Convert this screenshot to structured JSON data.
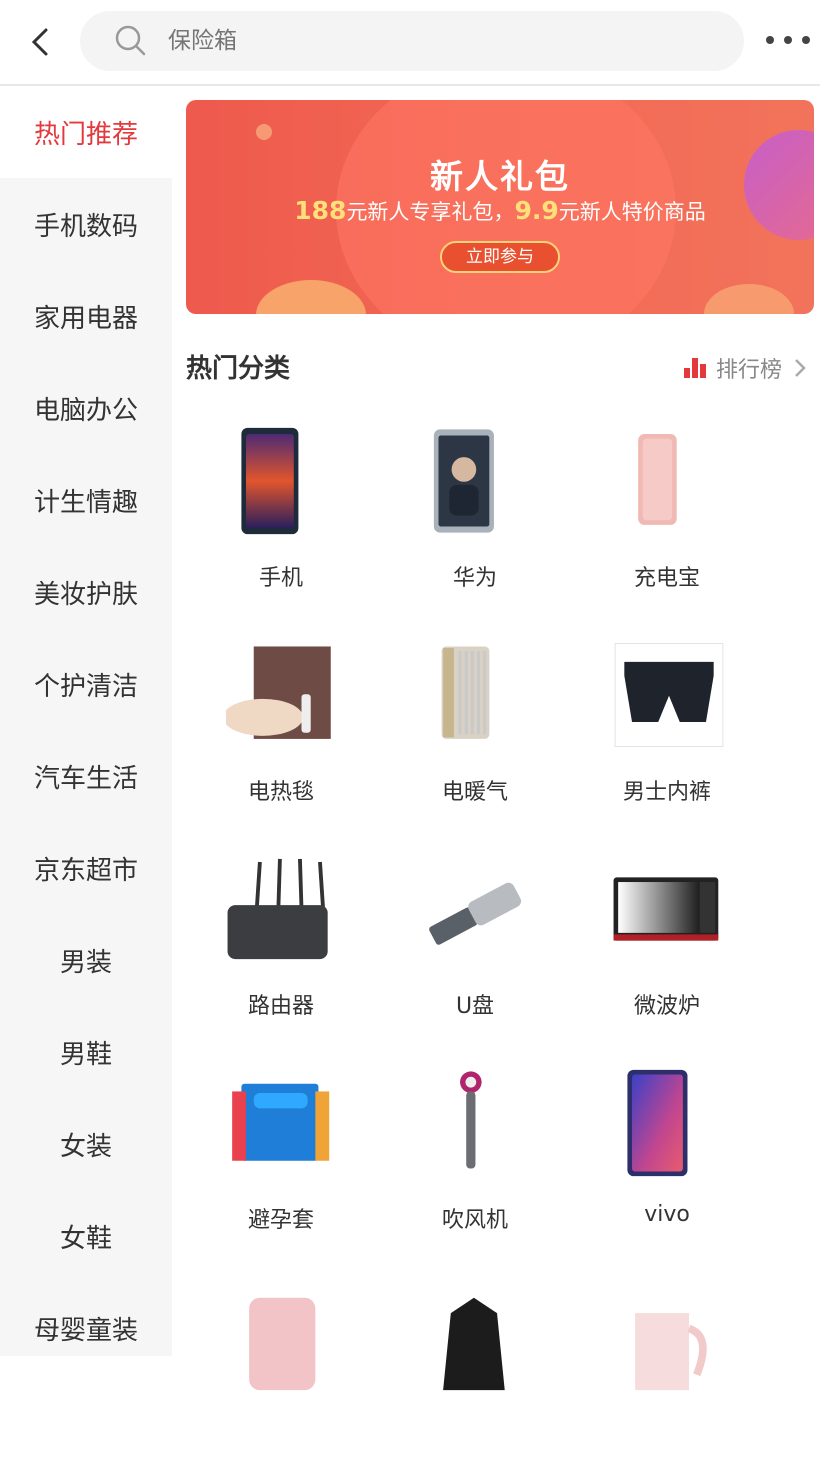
{
  "search": {
    "placeholder": "保险箱"
  },
  "sidebar": {
    "items": [
      {
        "label": "热门推荐",
        "active": true
      },
      {
        "label": "手机数码"
      },
      {
        "label": "家用电器"
      },
      {
        "label": "电脑办公"
      },
      {
        "label": "计生情趣"
      },
      {
        "label": "美妆护肤"
      },
      {
        "label": "个护清洁"
      },
      {
        "label": "汽车生活"
      },
      {
        "label": "京东超市"
      },
      {
        "label": "男装"
      },
      {
        "label": "男鞋"
      },
      {
        "label": "女装"
      },
      {
        "label": "女鞋"
      },
      {
        "label": "母婴童装"
      }
    ]
  },
  "banner": {
    "title": "新人礼包",
    "sub_amount1": "188",
    "sub_text1": "元新人专享礼包，",
    "sub_amount2": "9.9",
    "sub_text2": "元新人特价商品",
    "button": "立即参与"
  },
  "section": {
    "title": "热门分类",
    "ranking_label": "排行榜"
  },
  "categories": [
    {
      "label": "手机",
      "icon": "phone-image"
    },
    {
      "label": "华为",
      "icon": "huawei-phone-image"
    },
    {
      "label": "充电宝",
      "icon": "power-bank-image"
    },
    {
      "label": "电热毯",
      "icon": "electric-blanket-image"
    },
    {
      "label": "电暖气",
      "icon": "oil-heater-image"
    },
    {
      "label": "男士内裤",
      "icon": "mens-underwear-image"
    },
    {
      "label": "路由器",
      "icon": "router-image"
    },
    {
      "label": "U盘",
      "icon": "usb-drive-image"
    },
    {
      "label": "微波炉",
      "icon": "microwave-image"
    },
    {
      "label": "避孕套",
      "icon": "condom-box-image"
    },
    {
      "label": "吹风机",
      "icon": "hair-dryer-image"
    },
    {
      "label": "vivo",
      "icon": "vivo-phone-image"
    },
    {
      "label": "",
      "icon": "pink-towel-image"
    },
    {
      "label": "",
      "icon": "black-jacket-image"
    },
    {
      "label": "",
      "icon": "kettle-image"
    }
  ],
  "colors": {
    "accent": "#e4393c",
    "banner": "#ef5b4c"
  }
}
